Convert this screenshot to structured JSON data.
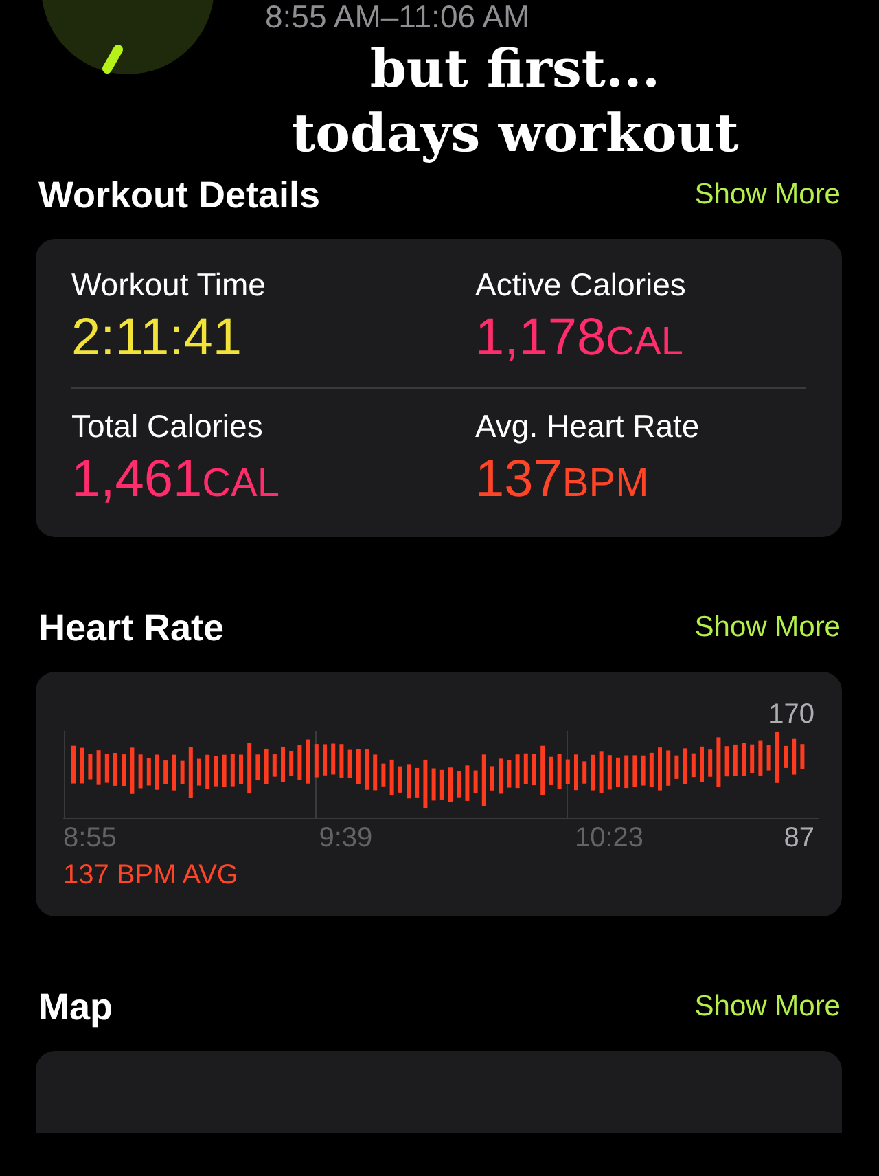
{
  "header": {
    "time_range": "8:55 AM–11:06 AM"
  },
  "caption": {
    "lines": [
      "but first...",
      "todays workout"
    ]
  },
  "sections": [
    {
      "kind": "metrics",
      "title": "Workout Details",
      "action": "Show More",
      "metrics": [
        {
          "label": "Workout Time",
          "value": "2:11:41",
          "color": "#f2e33a"
        },
        {
          "label": "Active Calories",
          "value": "1,178",
          "unit": "CAL",
          "color": "#ff2d6b"
        },
        {
          "label": "Total Calories",
          "value": "1,461",
          "unit": "CAL",
          "color": "#ff2d6b"
        },
        {
          "label": "Avg. Heart Rate",
          "value": "137",
          "unit": "BPM",
          "color": "#ff4527"
        }
      ]
    },
    {
      "kind": "heart_rate",
      "title": "Heart Rate",
      "action": "Show More",
      "max_label": "170",
      "min_label": "87",
      "times": [
        "8:55",
        "9:39",
        "10:23"
      ],
      "average": "137 BPM AVG"
    },
    {
      "kind": "map",
      "title": "Map",
      "action": "Show More"
    }
  ]
}
